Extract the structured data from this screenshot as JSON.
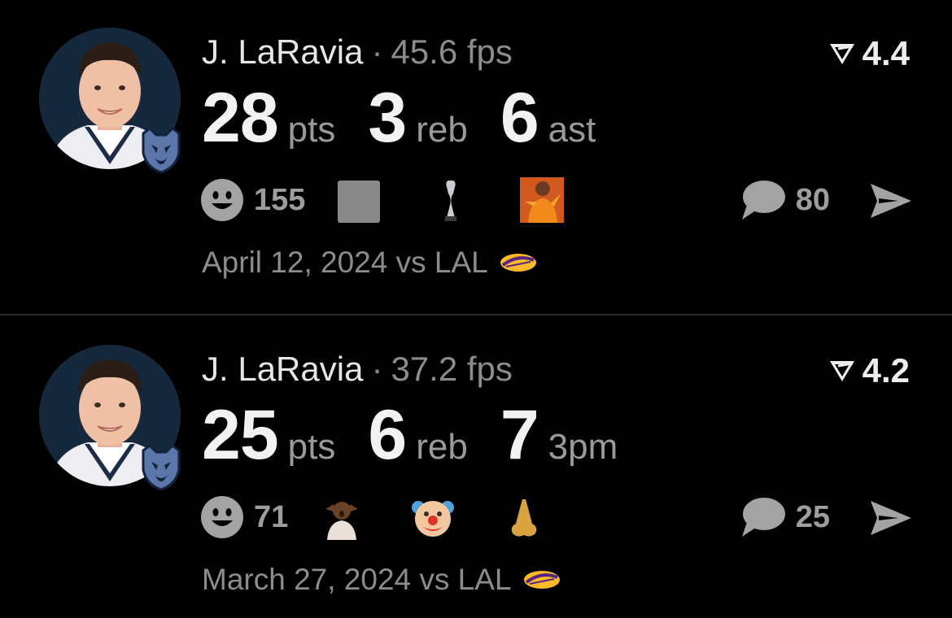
{
  "posts": [
    {
      "player_name": "J. LaRavia",
      "separator": "·",
      "fps": "45.6 fps",
      "rating": "4.4",
      "stats": [
        {
          "value": "28",
          "unit": "pts"
        },
        {
          "value": "3",
          "unit": "reb"
        },
        {
          "value": "6",
          "unit": "ast"
        }
      ],
      "reaction_count": "155",
      "reaction_emojis": [
        "gray-square",
        "trophy",
        "dancing-man"
      ],
      "comment_count": "80",
      "date": "April 12, 2024",
      "opponent": "vs LAL"
    },
    {
      "player_name": "J. LaRavia",
      "separator": "·",
      "fps": "37.2 fps",
      "rating": "4.2",
      "stats": [
        {
          "value": "25",
          "unit": "pts"
        },
        {
          "value": "6",
          "unit": "reb"
        },
        {
          "value": "7",
          "unit": "3pm"
        }
      ],
      "reaction_count": "71",
      "reaction_emojis": [
        "shocked-man",
        "clown-face",
        "nose"
      ],
      "comment_count": "25",
      "date": "March 27, 2024",
      "opponent": "vs LAL"
    }
  ],
  "colors": {
    "background": "#000000",
    "primary_text": "#ececec",
    "secondary_text": "#8c8c8c",
    "icon_gray": "#a3a3a3",
    "team_blue": "#5d76a9",
    "lakers_gold": "#fdb927",
    "lakers_purple": "#552583"
  }
}
